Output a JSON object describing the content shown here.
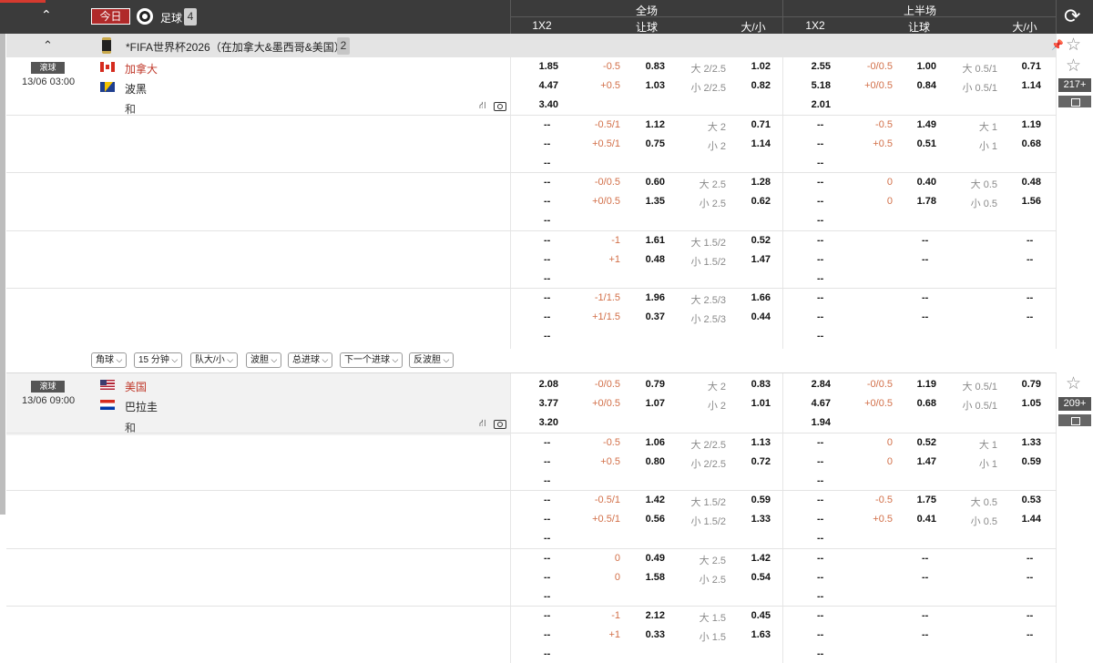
{
  "header": {
    "today_label": "今日",
    "sport_label": "足球",
    "sport_count": "4",
    "full_label": "全场",
    "half_label": "上半场",
    "col_1x2": "1X2",
    "col_hcap": "让球",
    "col_ou": "大/小"
  },
  "competition": {
    "name": "*FIFA世界杯2026（在加拿大&墨西哥&美国）",
    "count": "2"
  },
  "filters": [
    "角球",
    "15 分钟",
    "队大/小",
    "波胆",
    "总进球",
    "下一个进球",
    "反波胆"
  ],
  "matches": [
    {
      "status": "滚球",
      "time": "13/06 03:00",
      "home": "加拿大",
      "away": "波黑",
      "draw": "和",
      "more": "217+",
      "rows": [
        {
          "f1x2": [
            "1.85",
            "4.47",
            "3.40"
          ],
          "fh": [
            "-0.5",
            "0.83",
            "+0.5",
            "1.03"
          ],
          "fo": [
            "大 2/2.5",
            "1.02",
            "小 2/2.5",
            "0.82"
          ],
          "h1x2": [
            "2.55",
            "5.18",
            "2.01"
          ],
          "hh": [
            "-0/0.5",
            "1.00",
            "+0/0.5",
            "0.84"
          ],
          "ho": [
            "大 0.5/1",
            "0.71",
            "小 0.5/1",
            "1.14"
          ]
        },
        {
          "f1x2": [
            "--",
            "--",
            "--"
          ],
          "fh": [
            "-0.5/1",
            "1.12",
            "+0.5/1",
            "0.75"
          ],
          "fo": [
            "大 2",
            "0.71",
            "小 2",
            "1.14"
          ],
          "h1x2": [
            "--",
            "--",
            "--"
          ],
          "hh": [
            "-0.5",
            "1.49",
            "+0.5",
            "0.51"
          ],
          "ho": [
            "大 1",
            "1.19",
            "小 1",
            "0.68"
          ]
        },
        {
          "f1x2": [
            "--",
            "--",
            "--"
          ],
          "fh": [
            "-0/0.5",
            "0.60",
            "+0/0.5",
            "1.35"
          ],
          "fo": [
            "大 2.5",
            "1.28",
            "小 2.5",
            "0.62"
          ],
          "h1x2": [
            "--",
            "--",
            "--"
          ],
          "hh": [
            "0",
            "0.40",
            "0",
            "1.78"
          ],
          "ho": [
            "大 0.5",
            "0.48",
            "小 0.5",
            "1.56"
          ]
        },
        {
          "f1x2": [
            "--",
            "--",
            "--"
          ],
          "fh": [
            "-1",
            "1.61",
            "+1",
            "0.48"
          ],
          "fo": [
            "大 1.5/2",
            "0.52",
            "小 1.5/2",
            "1.47"
          ],
          "h1x2": [
            "--",
            "--",
            "--"
          ],
          "hh": [
            "",
            "--",
            "",
            "--"
          ],
          "ho": [
            "",
            "--",
            "",
            "--"
          ]
        },
        {
          "f1x2": [
            "--",
            "--",
            "--"
          ],
          "fh": [
            "-1/1.5",
            "1.96",
            "+1/1.5",
            "0.37"
          ],
          "fo": [
            "大 2.5/3",
            "1.66",
            "小 2.5/3",
            "0.44"
          ],
          "h1x2": [
            "--",
            "--",
            "--"
          ],
          "hh": [
            "",
            "--",
            "",
            "--"
          ],
          "ho": [
            "",
            "--",
            "",
            "--"
          ]
        }
      ]
    },
    {
      "status": "滚球",
      "time": "13/06 09:00",
      "home": "美国",
      "away": "巴拉圭",
      "draw": "和",
      "more": "209+",
      "rows": [
        {
          "f1x2": [
            "2.08",
            "3.77",
            "3.20"
          ],
          "fh": [
            "-0/0.5",
            "0.79",
            "+0/0.5",
            "1.07"
          ],
          "fo": [
            "大 2",
            "0.83",
            "小 2",
            "1.01"
          ],
          "h1x2": [
            "2.84",
            "4.67",
            "1.94"
          ],
          "hh": [
            "-0/0.5",
            "1.19",
            "+0/0.5",
            "0.68"
          ],
          "ho": [
            "大 0.5/1",
            "0.79",
            "小 0.5/1",
            "1.05"
          ]
        },
        {
          "f1x2": [
            "--",
            "--",
            "--"
          ],
          "fh": [
            "-0.5",
            "1.06",
            "+0.5",
            "0.80"
          ],
          "fo": [
            "大 2/2.5",
            "1.13",
            "小 2/2.5",
            "0.72"
          ],
          "h1x2": [
            "--",
            "--",
            "--"
          ],
          "hh": [
            "0",
            "0.52",
            "0",
            "1.47"
          ],
          "ho": [
            "大 1",
            "1.33",
            "小 1",
            "0.59"
          ]
        },
        {
          "f1x2": [
            "--",
            "--",
            "--"
          ],
          "fh": [
            "-0.5/1",
            "1.42",
            "+0.5/1",
            "0.56"
          ],
          "fo": [
            "大 1.5/2",
            "0.59",
            "小 1.5/2",
            "1.33"
          ],
          "h1x2": [
            "--",
            "--",
            "--"
          ],
          "hh": [
            "-0.5",
            "1.75",
            "+0.5",
            "0.41"
          ],
          "ho": [
            "大 0.5",
            "0.53",
            "小 0.5",
            "1.44"
          ]
        },
        {
          "f1x2": [
            "--",
            "--",
            "--"
          ],
          "fh": [
            "0",
            "0.49",
            "0",
            "1.58"
          ],
          "fo": [
            "大 2.5",
            "1.42",
            "小 2.5",
            "0.54"
          ],
          "h1x2": [
            "--",
            "--",
            "--"
          ],
          "hh": [
            "",
            "--",
            "",
            "--"
          ],
          "ho": [
            "",
            "--",
            "",
            "--"
          ]
        },
        {
          "f1x2": [
            "--",
            "--",
            "--"
          ],
          "fh": [
            "-1",
            "2.12",
            "+1",
            "0.33"
          ],
          "fo": [
            "大 1.5",
            "0.45",
            "小 1.5",
            "1.63"
          ],
          "h1x2": [
            "--",
            "--",
            "--"
          ],
          "hh": [
            "",
            "--",
            "",
            "--"
          ],
          "ho": [
            "",
            "--",
            "",
            "--"
          ]
        }
      ]
    }
  ],
  "colors": {
    "header_bg": "#3b3b3b",
    "accent": "#d53a2f",
    "handicap": "#d26f48",
    "ou_label": "#8a8a8a"
  },
  "icons": [
    "chevron-up-icon",
    "soccer-ball-icon",
    "refresh-icon",
    "pin-icon",
    "star-icon",
    "trophy-icon",
    "pitch-icon",
    "live-tv-icon",
    "stats-icon"
  ]
}
